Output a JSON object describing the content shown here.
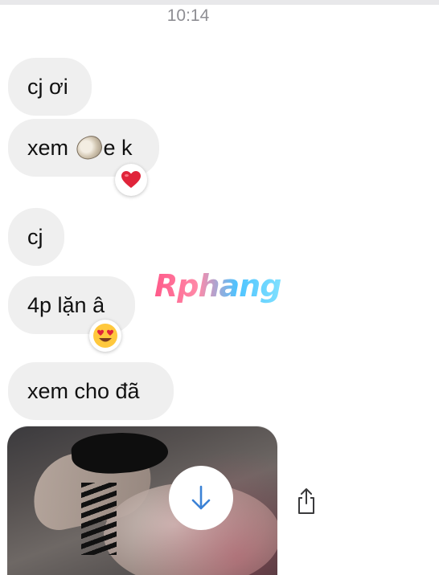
{
  "status": {
    "time": "10:14"
  },
  "messages": [
    {
      "text": "cj ơi"
    },
    {
      "text_before": "xem ",
      "emoji": "oyster",
      "text_after": "e k",
      "reaction": "heart"
    },
    {
      "text": "cj"
    },
    {
      "text": "4p lặn â",
      "reaction": "heart-eyes"
    },
    {
      "text": "xem cho đã"
    }
  ],
  "watermark": "Rphang",
  "media": {
    "type": "video",
    "content": "censored"
  },
  "actions": {
    "download": "download-arrow-icon",
    "share": "share-icon"
  },
  "colors": {
    "bubble": "#efefef",
    "timestamp": "#8e8e93",
    "download_arrow": "#3b82d6",
    "heart": "#e0243a"
  }
}
